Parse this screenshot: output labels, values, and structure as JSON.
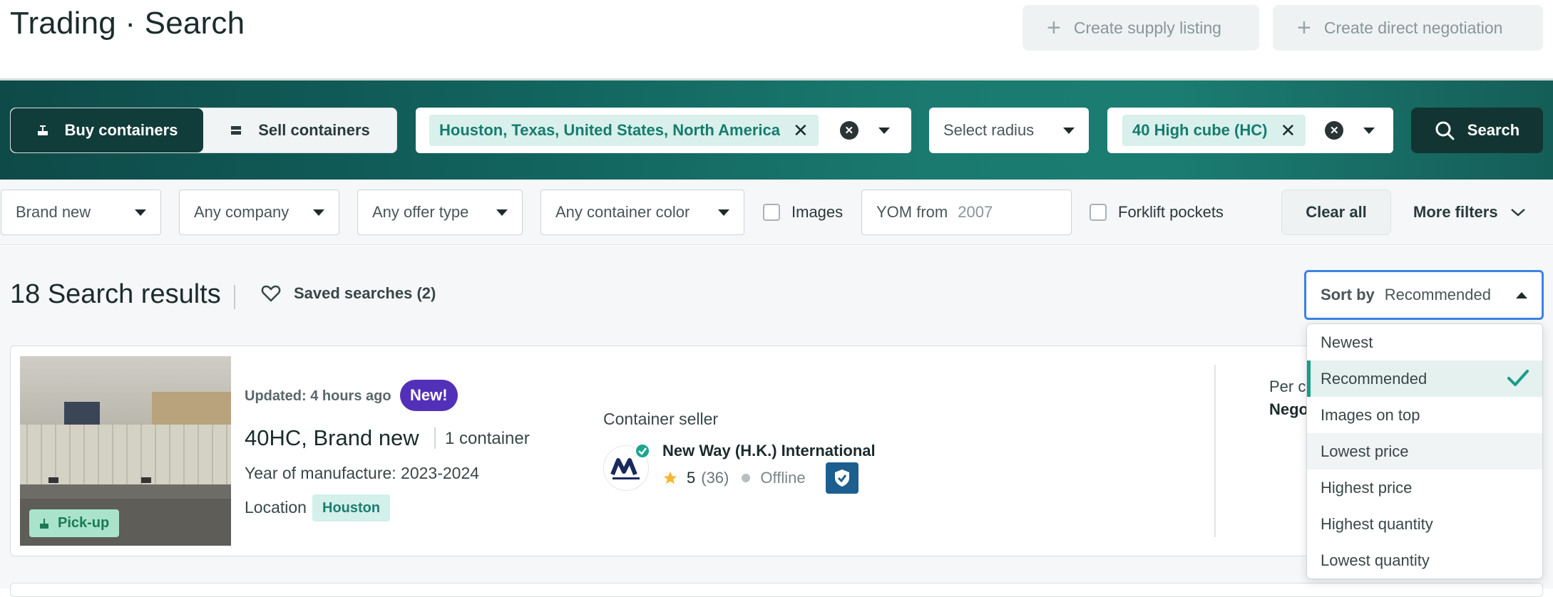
{
  "header": {
    "title": "Trading · Search",
    "create_supply_label": "Create supply listing",
    "create_negotiation_label": "Create direct negotiation"
  },
  "search": {
    "buy_label": "Buy containers",
    "sell_label": "Sell containers",
    "location_chip": "Houston, Texas, United States, North America",
    "radius_placeholder": "Select radius",
    "type_chip": "40 High cube (HC)",
    "search_label": "Search"
  },
  "filters": {
    "condition": "Brand new",
    "company": "Any company",
    "offer_type": "Any offer type",
    "container_color": "Any container color",
    "images_label": "Images",
    "yom_label": "YOM from",
    "yom_value": "2007",
    "forklift_label": "Forklift pockets",
    "clear_all_label": "Clear all",
    "more_filters_label": "More filters"
  },
  "results": {
    "count_text": "18 Search results",
    "saved_searches": "Saved searches (2)",
    "sort_label": "Sort by",
    "sort_value": "Recommended"
  },
  "sort_menu": {
    "options": [
      "Newest",
      "Recommended",
      "Images on top",
      "Lowest price",
      "Highest price",
      "Highest quantity",
      "Lowest quantity"
    ],
    "selected": "Recommended",
    "hovered": "Lowest price"
  },
  "card": {
    "pickup_badge": "Pick-up",
    "updated": "Updated: 4 hours ago",
    "new_badge": "New!",
    "title": "40HC, Brand new",
    "quantity": "1 container",
    "yom": "Year of manufacture: 2023-2024",
    "location_label": "Location",
    "location_value": "Houston",
    "seller_label": "Container seller",
    "seller_name": "New Way (H.K.) International",
    "rating": "5",
    "rating_count": "(36)",
    "status": "Offline",
    "price_label": "Per c",
    "price_value": "Nego"
  },
  "colors": {
    "brand_dark": "#103c3a",
    "accent_teal": "#1a9c88",
    "new_badge": "#5230b8",
    "focus_blue": "#3b82e6"
  }
}
